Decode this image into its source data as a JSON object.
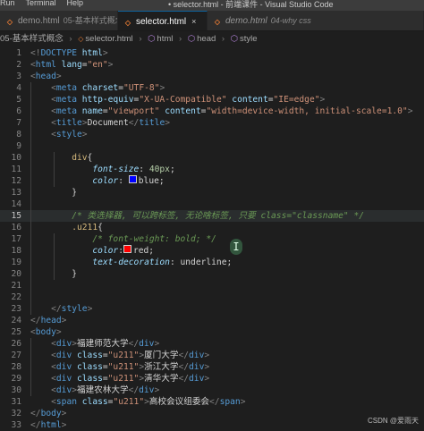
{
  "titlebar": {
    "menu": [
      "Run",
      "Terminal",
      "Help"
    ],
    "title": "• selector.html - 前端课件 - Visual Studio Code"
  },
  "tabs": [
    {
      "label": "demo.html",
      "sub": "05-基本样式概念",
      "active": false
    },
    {
      "label": "selector.html",
      "sub": "",
      "active": true
    },
    {
      "label": "demo.html",
      "sub": "04-why css",
      "active": false
    }
  ],
  "tab_close_glyph": "×",
  "breadcrumb": [
    "05-基本样式概念",
    "selector.html",
    "html",
    "head",
    "style"
  ],
  "code_lines": [
    {
      "n": "1",
      "tokens": [
        [
          "p",
          "<!"
        ],
        [
          "t",
          "DOCTYPE"
        ],
        [
          "a",
          " html"
        ],
        [
          "p",
          ">"
        ]
      ]
    },
    {
      "n": "2",
      "tokens": [
        [
          "p",
          "<"
        ],
        [
          "t",
          "html"
        ],
        [
          "a",
          " lang"
        ],
        [
          "x",
          "="
        ],
        [
          "s",
          "\"en\""
        ],
        [
          "p",
          ">"
        ]
      ]
    },
    {
      "n": "3",
      "tokens": [
        [
          "p",
          "<"
        ],
        [
          "t",
          "head"
        ],
        [
          "p",
          ">"
        ]
      ]
    },
    {
      "n": "4",
      "tokens": [
        [
          "x",
          "    "
        ],
        [
          "p",
          "<"
        ],
        [
          "t",
          "meta"
        ],
        [
          "a",
          " charset"
        ],
        [
          "x",
          "="
        ],
        [
          "s",
          "\"UTF-8\""
        ],
        [
          "p",
          ">"
        ]
      ]
    },
    {
      "n": "5",
      "tokens": [
        [
          "x",
          "    "
        ],
        [
          "p",
          "<"
        ],
        [
          "t",
          "meta"
        ],
        [
          "a",
          " http-equiv"
        ],
        [
          "x",
          "="
        ],
        [
          "s",
          "\"X-UA-Compatible\""
        ],
        [
          "a",
          " content"
        ],
        [
          "x",
          "="
        ],
        [
          "s",
          "\"IE=edge\""
        ],
        [
          "p",
          ">"
        ]
      ]
    },
    {
      "n": "6",
      "tokens": [
        [
          "x",
          "    "
        ],
        [
          "p",
          "<"
        ],
        [
          "t",
          "meta"
        ],
        [
          "a",
          " name"
        ],
        [
          "x",
          "="
        ],
        [
          "s",
          "\"viewport\""
        ],
        [
          "a",
          " content"
        ],
        [
          "x",
          "="
        ],
        [
          "s",
          "\"width=device-width, initial-scale=1.0\""
        ],
        [
          "p",
          ">"
        ]
      ]
    },
    {
      "n": "7",
      "tokens": [
        [
          "x",
          "    "
        ],
        [
          "p",
          "<"
        ],
        [
          "t",
          "title"
        ],
        [
          "p",
          ">"
        ],
        [
          "x",
          "Document"
        ],
        [
          "p",
          "</"
        ],
        [
          "t",
          "title"
        ],
        [
          "p",
          ">"
        ]
      ]
    },
    {
      "n": "8",
      "tokens": [
        [
          "x",
          "    "
        ],
        [
          "p",
          "<"
        ],
        [
          "t",
          "style"
        ],
        [
          "p",
          ">"
        ]
      ]
    },
    {
      "n": "9",
      "tokens": []
    },
    {
      "n": "10",
      "tokens": [
        [
          "x",
          "        "
        ],
        [
          "sel",
          "div"
        ],
        [
          "x",
          "{"
        ]
      ]
    },
    {
      "n": "11",
      "tokens": [
        [
          "x",
          "            "
        ],
        [
          "pr",
          "font-size"
        ],
        [
          "x",
          ": "
        ],
        [
          "num",
          "40px"
        ],
        [
          "x",
          ";"
        ]
      ]
    },
    {
      "n": "12",
      "tokens": [
        [
          "x",
          "            "
        ],
        [
          "pr",
          "color"
        ],
        [
          "x",
          ": "
        ],
        [
          "sw",
          "#0000ff"
        ],
        [
          "x",
          "blue;"
        ]
      ]
    },
    {
      "n": "13",
      "tokens": [
        [
          "x",
          "        }"
        ]
      ]
    },
    {
      "n": "14",
      "tokens": []
    },
    {
      "n": "15",
      "tokens": [
        [
          "x",
          "        "
        ],
        [
          "c",
          "/* 类选择器, 可以跨标签, 无论啥标签, 只要 class=\"classname\" */"
        ]
      ],
      "hl": true
    },
    {
      "n": "16",
      "tokens": [
        [
          "x",
          "        "
        ],
        [
          "sel",
          ".u211"
        ],
        [
          "x",
          "{"
        ]
      ]
    },
    {
      "n": "17",
      "tokens": [
        [
          "x",
          "            "
        ],
        [
          "c",
          "/* font-weight: bold; */"
        ]
      ]
    },
    {
      "n": "18",
      "tokens": [
        [
          "x",
          "            "
        ],
        [
          "pr",
          "color"
        ],
        [
          "x",
          ":"
        ],
        [
          "sw",
          "#ff0000"
        ],
        [
          "x",
          "red;"
        ]
      ]
    },
    {
      "n": "19",
      "tokens": [
        [
          "x",
          "            "
        ],
        [
          "pr",
          "text-decoration"
        ],
        [
          "x",
          ": underline;"
        ]
      ]
    },
    {
      "n": "20",
      "tokens": [
        [
          "x",
          "        }"
        ]
      ]
    },
    {
      "n": "21",
      "tokens": []
    },
    {
      "n": "22",
      "tokens": []
    },
    {
      "n": "23",
      "tokens": [
        [
          "x",
          "    "
        ],
        [
          "p",
          "</"
        ],
        [
          "t",
          "style"
        ],
        [
          "p",
          ">"
        ]
      ]
    },
    {
      "n": "24",
      "tokens": [
        [
          "p",
          "</"
        ],
        [
          "t",
          "head"
        ],
        [
          "p",
          ">"
        ]
      ]
    },
    {
      "n": "25",
      "tokens": [
        [
          "p",
          "<"
        ],
        [
          "t",
          "body"
        ],
        [
          "p",
          ">"
        ]
      ]
    },
    {
      "n": "26",
      "tokens": [
        [
          "x",
          "    "
        ],
        [
          "p",
          "<"
        ],
        [
          "t",
          "div"
        ],
        [
          "p",
          ">"
        ],
        [
          "x",
          "福建师范大学"
        ],
        [
          "p",
          "</"
        ],
        [
          "t",
          "div"
        ],
        [
          "p",
          ">"
        ]
      ]
    },
    {
      "n": "27",
      "tokens": [
        [
          "x",
          "    "
        ],
        [
          "p",
          "<"
        ],
        [
          "t",
          "div"
        ],
        [
          "a",
          " class"
        ],
        [
          "x",
          "="
        ],
        [
          "s",
          "\"u211\""
        ],
        [
          "p",
          ">"
        ],
        [
          "x",
          "厦门大学"
        ],
        [
          "p",
          "</"
        ],
        [
          "t",
          "div"
        ],
        [
          "p",
          ">"
        ]
      ]
    },
    {
      "n": "28",
      "tokens": [
        [
          "x",
          "    "
        ],
        [
          "p",
          "<"
        ],
        [
          "t",
          "div"
        ],
        [
          "a",
          " class"
        ],
        [
          "x",
          "="
        ],
        [
          "s",
          "\"u211\""
        ],
        [
          "p",
          ">"
        ],
        [
          "x",
          "浙江大学"
        ],
        [
          "p",
          "</"
        ],
        [
          "t",
          "div"
        ],
        [
          "p",
          ">"
        ]
      ]
    },
    {
      "n": "29",
      "tokens": [
        [
          "x",
          "    "
        ],
        [
          "p",
          "<"
        ],
        [
          "t",
          "div"
        ],
        [
          "a",
          " class"
        ],
        [
          "x",
          "="
        ],
        [
          "s",
          "\"u211\""
        ],
        [
          "p",
          ">"
        ],
        [
          "x",
          "清华大学"
        ],
        [
          "p",
          "</"
        ],
        [
          "t",
          "div"
        ],
        [
          "p",
          ">"
        ]
      ]
    },
    {
      "n": "30",
      "tokens": [
        [
          "x",
          "    "
        ],
        [
          "p",
          "<"
        ],
        [
          "t",
          "div"
        ],
        [
          "p",
          ">"
        ],
        [
          "x",
          "福建农林大学"
        ],
        [
          "p",
          "</"
        ],
        [
          "t",
          "div"
        ],
        [
          "p",
          ">"
        ]
      ]
    },
    {
      "n": "31",
      "tokens": [
        [
          "x",
          "    "
        ],
        [
          "p",
          "<"
        ],
        [
          "t",
          "span"
        ],
        [
          "a",
          " class"
        ],
        [
          "x",
          "="
        ],
        [
          "s",
          "\"u211\""
        ],
        [
          "p",
          ">"
        ],
        [
          "x",
          "高校会议组委会"
        ],
        [
          "p",
          "</"
        ],
        [
          "t",
          "span"
        ],
        [
          "p",
          ">"
        ]
      ]
    },
    {
      "n": "32",
      "tokens": [
        [
          "p",
          "</"
        ],
        [
          "t",
          "body"
        ],
        [
          "p",
          ">"
        ]
      ]
    },
    {
      "n": "33",
      "tokens": [
        [
          "p",
          "</"
        ],
        [
          "t",
          "html"
        ],
        [
          "p",
          ">"
        ]
      ]
    }
  ],
  "cursor_glyph": "I",
  "watermark": "CSDN @爱雨天"
}
